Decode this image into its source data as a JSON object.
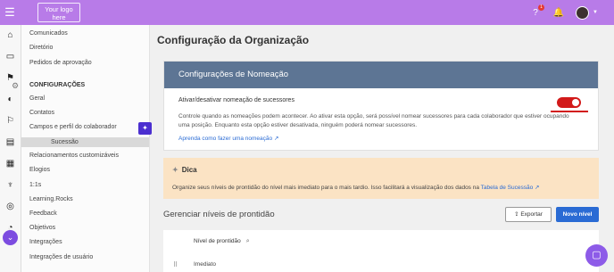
{
  "topbar": {
    "logo_text": "Your logo here",
    "notification_count": "1",
    "accent": "#b87be8"
  },
  "rail_icons": [
    "home-icon",
    "chat-icon",
    "flag-icon",
    "palette-icon",
    "flag-outline-icon",
    "clipboard-icon",
    "presentation-icon",
    "trophy-icon",
    "target-icon",
    "gauge-icon",
    "chevron-down-icon",
    "building-icon"
  ],
  "sidebar": {
    "items_top": [
      "Comunicados",
      "Diretório",
      "Pedidos de aprovação"
    ],
    "section_label": "CONFIGURAÇÕES",
    "items": [
      "Geral",
      "Contatos",
      "Campos e perfil do colaborador",
      "Sucessão",
      "Relacionamentos customizáveis",
      "Elogios",
      "1:1s",
      "Learning.Rocks",
      "Feedback",
      "Objetivos",
      "Integrações",
      "Integrações de usuário"
    ],
    "active_index": 3
  },
  "page_title": "Configuração da Organização",
  "nomination": {
    "title": "Configurações de Nomeação",
    "toggle_label": "Ativar/desativar nomeação de sucessores",
    "toggle_on": true,
    "description": "Controle quando as nomeações podem acontecer. Ao ativar esta opção, será possível nomear sucessores para cada colaborador que estiver ocupando uma posição. Enquanto esta opção estiver desativada, ninguém poderá nomear sucessores.",
    "learn_link": "Aprenda como fazer uma nomeação"
  },
  "tip": {
    "title": "Dica",
    "text": "Organize seus níveis de prontidão do nível mais imediato para o mais tardio. Isso facilitará a visualização dos dados na",
    "link": "Tabela de Sucessão"
  },
  "readiness": {
    "title": "Gerenciar níveis de prontidão",
    "export_label": "Exportar",
    "new_label": "Novo nível",
    "column_header": "Nível de prontidão",
    "rows": [
      "Imediato"
    ]
  }
}
